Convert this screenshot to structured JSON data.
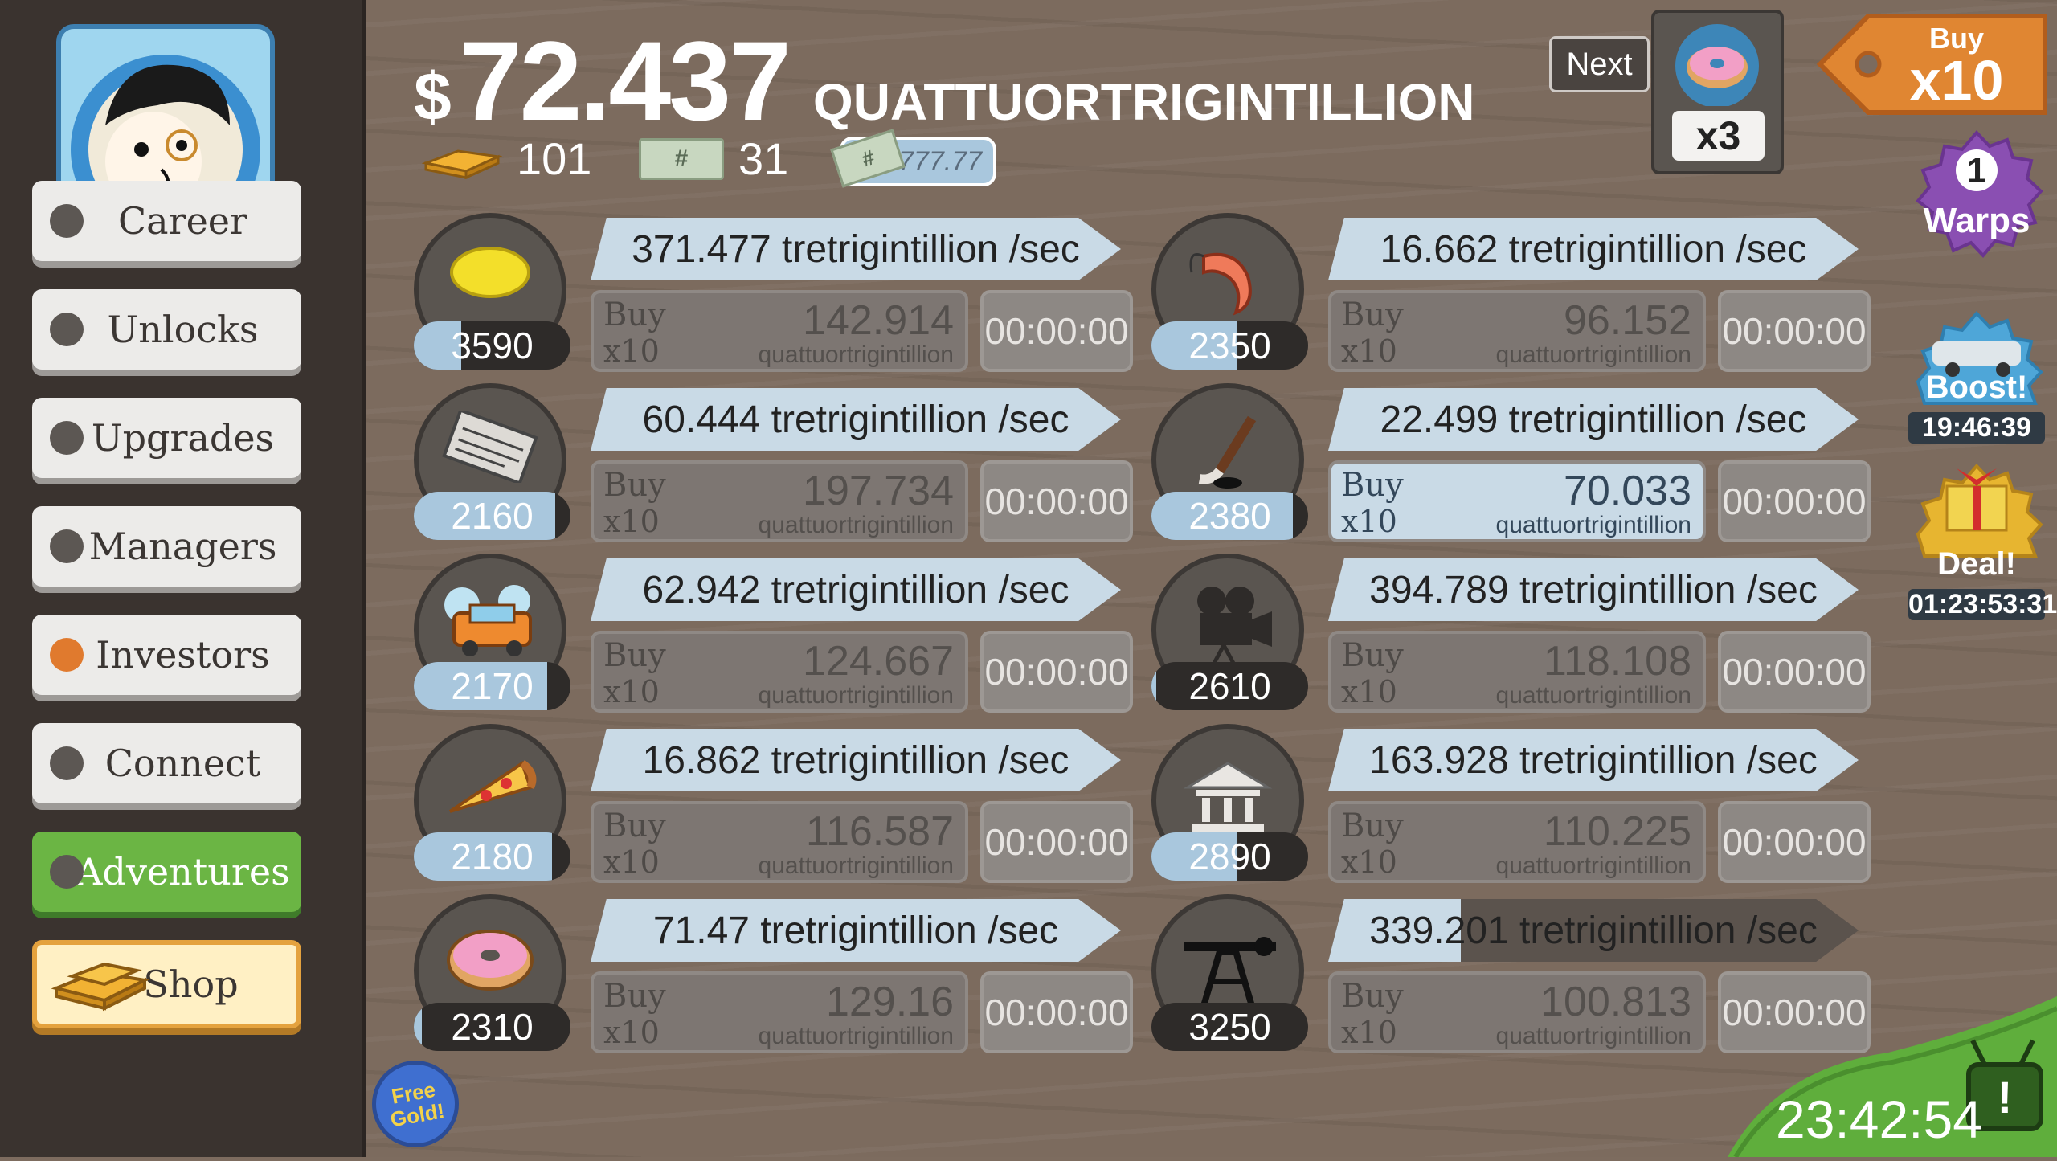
{
  "header": {
    "currency_symbol": "$",
    "money": "72.437",
    "money_unit": "QUATTUORTRIGINTILLION",
    "gold": "101",
    "megabucks": "31",
    "multiplier": "x777.77"
  },
  "sidebar": {
    "items": [
      {
        "label": "Career"
      },
      {
        "label": "Unlocks"
      },
      {
        "label": "Upgrades"
      },
      {
        "label": "Managers"
      },
      {
        "label": "Investors"
      },
      {
        "label": "Connect"
      },
      {
        "label": "Adventures"
      }
    ],
    "shop_label": "Shop"
  },
  "buy_label": "Buy",
  "buy_qty": "x10",
  "businesses": [
    {
      "icon": "lemon-icon",
      "count": "3590",
      "rate": "371.477 tretrigintillion /sec",
      "cost": "142.914",
      "cost_unit": "quattuortrigintillion",
      "timer": "00:00:00",
      "progress": 0.3
    },
    {
      "icon": "newspaper-icon",
      "count": "2160",
      "rate": "60.444 tretrigintillion /sec",
      "cost": "197.734",
      "cost_unit": "quattuortrigintillion",
      "timer": "00:00:00",
      "progress": 0.9
    },
    {
      "icon": "car-wash-icon",
      "count": "2170",
      "rate": "62.942 tretrigintillion /sec",
      "cost": "124.667",
      "cost_unit": "quattuortrigintillion",
      "timer": "00:00:00",
      "progress": 0.85
    },
    {
      "icon": "pizza-icon",
      "count": "2180",
      "rate": "16.862 tretrigintillion /sec",
      "cost": "116.587",
      "cost_unit": "quattuortrigintillion",
      "timer": "00:00:00",
      "progress": 0.88
    },
    {
      "icon": "donut-icon",
      "count": "2310",
      "rate": "71.47 tretrigintillion /sec",
      "cost": "129.16",
      "cost_unit": "quattuortrigintillion",
      "timer": "00:00:00",
      "progress": 0.05
    },
    {
      "icon": "shrimp-icon",
      "count": "2350",
      "rate": "16.662 tretrigintillion /sec",
      "cost": "96.152",
      "cost_unit": "quattuortrigintillion",
      "timer": "00:00:00",
      "progress": 0.55
    },
    {
      "icon": "hockey-icon",
      "count": "2380",
      "rate": "22.499 tretrigintillion /sec",
      "cost": "70.033",
      "cost_unit": "quattuortrigintillion",
      "timer": "00:00:00",
      "progress": 0.9
    },
    {
      "icon": "movie-camera-icon",
      "count": "2610",
      "rate": "394.789 tretrigintillion /sec",
      "cost": "118.108",
      "cost_unit": "quattuortrigintillion",
      "timer": "00:00:00",
      "progress": 0.03
    },
    {
      "icon": "bank-icon",
      "count": "2890",
      "rate": "163.928 tretrigintillion /sec",
      "cost": "110.225",
      "cost_unit": "quattuortrigintillion",
      "timer": "00:00:00",
      "progress": 0.55
    },
    {
      "icon": "oil-rig-icon",
      "count": "3250",
      "rate": "339.201 tretrigintillion /sec",
      "cost": "100.813",
      "cost_unit": "quattuortrigintillion",
      "timer": "00:00:00",
      "progress": 0.0,
      "rate_progress": 0.25
    }
  ],
  "right": {
    "next_label": "Next",
    "unlock_mult": "x3",
    "buy_word": "Buy",
    "buy_mult": "x10",
    "warps_count": "1",
    "warps_label": "Warps",
    "boost_label": "Boost!",
    "boost_timer": "19:46:39",
    "deal_label": "Deal!",
    "deal_timer": "01:23:53:31",
    "clock": "23:42:54",
    "free_gold": "Free Gold!"
  },
  "colors": {
    "accent_blue": "#c9dae6",
    "green": "#6bb544",
    "orange": "#e07a2e"
  }
}
